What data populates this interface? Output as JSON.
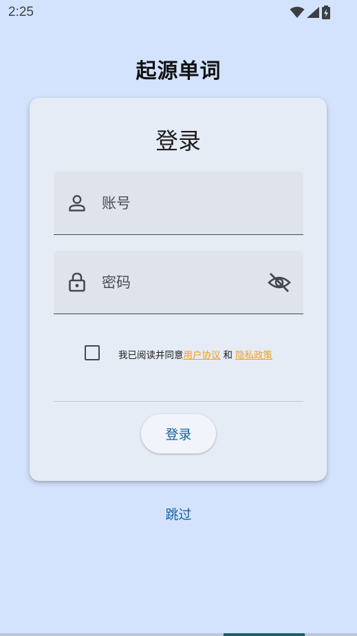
{
  "status_bar": {
    "time": "2:25"
  },
  "app": {
    "title": "起源单词"
  },
  "login_card": {
    "title": "登录",
    "account_field": {
      "placeholder": "账号",
      "value": ""
    },
    "password_field": {
      "placeholder": "密码",
      "value": ""
    },
    "agreement": {
      "checked": false,
      "prefix": "我已阅读并同意",
      "user_agreement": "用户协议",
      "conjunction": "和",
      "privacy_policy": "隐私政策"
    },
    "login_button": "登录"
  },
  "skip_label": "跳过",
  "colors": {
    "background": "#d3e3fd",
    "card": "#e6ecf5",
    "primary_text": "#16619e",
    "link": "#f0a020"
  },
  "icons": {
    "account": "person-icon",
    "password": "lock-icon",
    "visibility": "visibility-off-icon"
  }
}
